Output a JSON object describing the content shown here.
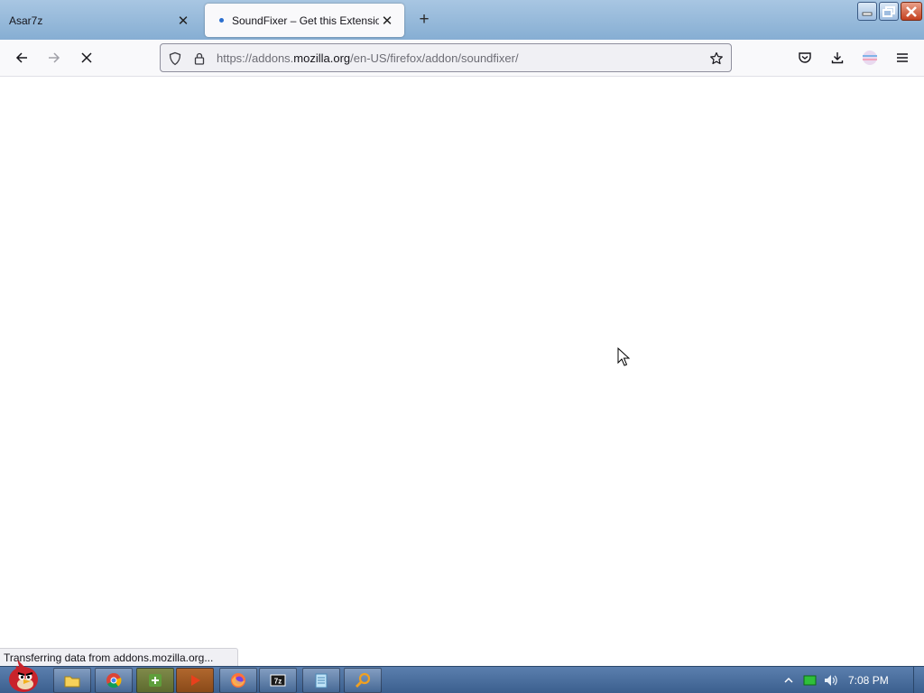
{
  "tabs": [
    {
      "title": "Asar7z",
      "active": false
    },
    {
      "title": "SoundFixer – Get this Extension",
      "active": true
    }
  ],
  "navbar": {
    "url_prefix": "https://addons.",
    "url_host": "mozilla.org",
    "url_path": "/en-US/firefox/addon/soundfixer/"
  },
  "status": {
    "text": "Transferring data from addons.mozilla.org..."
  },
  "taskbar": {
    "clock": "7:08 PM",
    "items": [
      "start-orb",
      "file-explorer",
      "chrome",
      "app-green",
      "media-player",
      "firefox",
      "7zip",
      "notepad",
      "search-tool"
    ]
  },
  "colors": {
    "accent": "#2b6fcf",
    "taskbar": "#4a6f9f"
  }
}
